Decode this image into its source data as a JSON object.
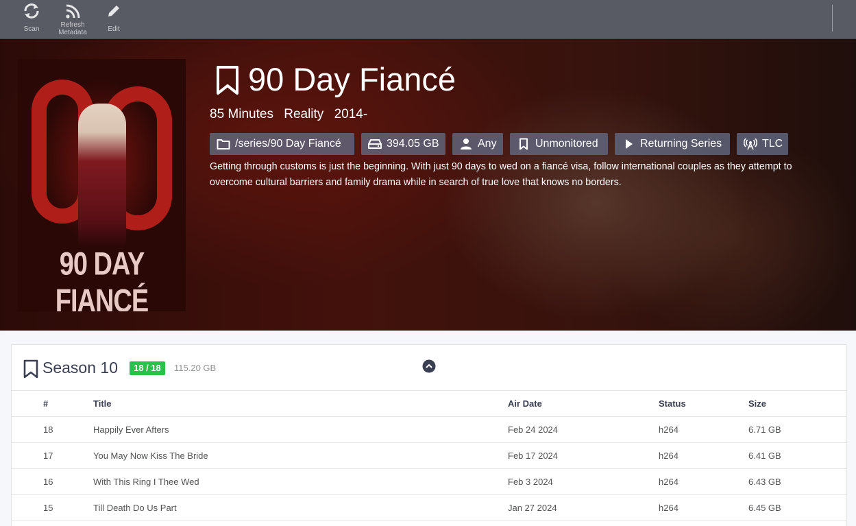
{
  "toolbar": {
    "buttons": [
      {
        "label": "Scan",
        "icon": "refresh-icon"
      },
      {
        "label_line1": "Refresh",
        "label_line2": "Metadata",
        "icon": "rss-icon"
      },
      {
        "label": "Edit",
        "icon": "pencil-icon"
      }
    ]
  },
  "series": {
    "title": "90 Day Fiancé",
    "poster_title": "90 DAY FIANCÉ",
    "runtime": "85 Minutes",
    "genre": "Reality",
    "years": "2014-",
    "tags": {
      "path": "/series/90 Day Fiancé",
      "size": "394.05 GB",
      "profile": "Any",
      "monitored": "Unmonitored",
      "status": "Returning Series",
      "network": "TLC"
    },
    "overview": "Getting through customs is just the beginning. With just 90 days to wed on a fiancé visa, follow international couples as they attempt to overcome cultural barriers and family drama while in search of true love that knows no borders."
  },
  "season": {
    "title": "Season 10",
    "episode_badge": "18 / 18",
    "badge_color": "#27c24c",
    "size": "115.20 GB",
    "columns": {
      "number": "#",
      "title": "Title",
      "air_date": "Air Date",
      "status": "Status",
      "size": "Size"
    },
    "episodes": [
      {
        "number": "18",
        "title": "Happily Ever Afters",
        "air_date": "Feb 24 2024",
        "status": "h264",
        "size": "6.71 GB"
      },
      {
        "number": "17",
        "title": "You May Now Kiss The Bride",
        "air_date": "Feb 17 2024",
        "status": "h264",
        "size": "6.41 GB"
      },
      {
        "number": "16",
        "title": "With This Ring I Thee Wed",
        "air_date": "Feb 3 2024",
        "status": "h264",
        "size": "6.43 GB"
      },
      {
        "number": "15",
        "title": "Till Death Do Us Part",
        "air_date": "Jan 27 2024",
        "status": "h264",
        "size": "6.45 GB"
      }
    ]
  }
}
